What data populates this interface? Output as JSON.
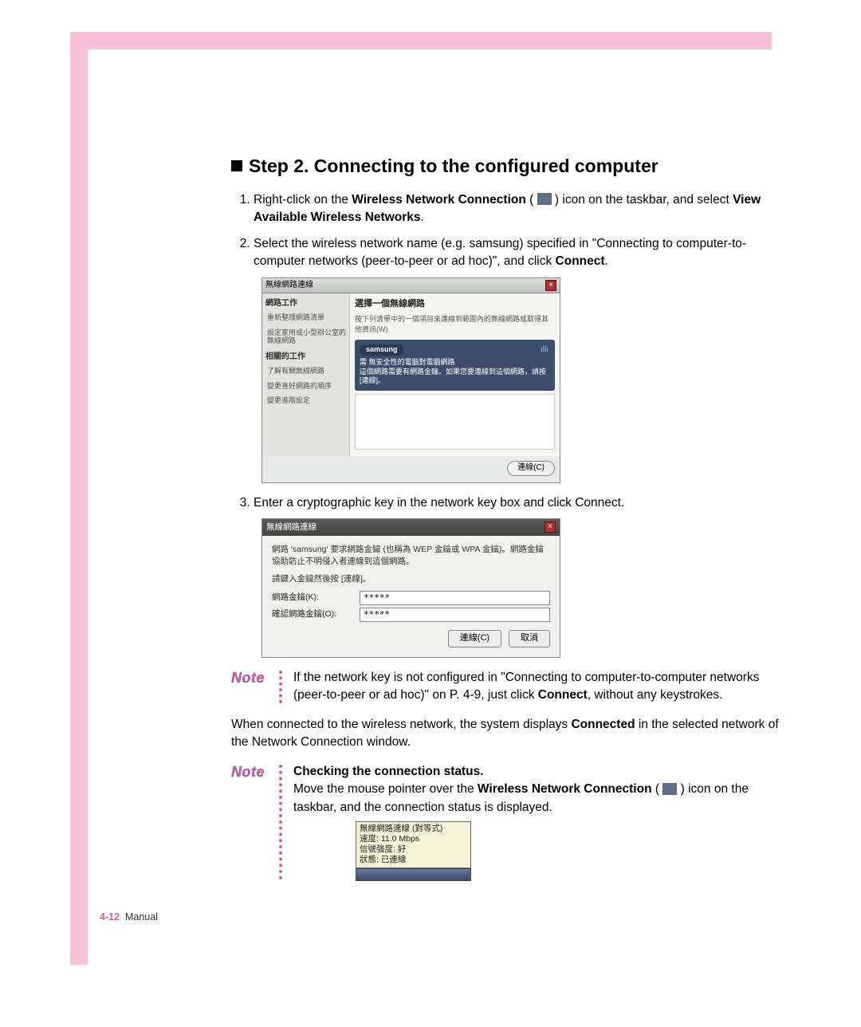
{
  "step": {
    "heading": "Step 2. Connecting to the configured computer",
    "items": [
      {
        "pre": "Right-click on the ",
        "bold1": "Wireless Network Connection",
        "mid": " ( ",
        "post_icon": " ) icon on the taskbar, and select ",
        "bold2": "View Available Wireless Networks",
        "end": "."
      },
      {
        "text_a": "Select the wireless network name (e.g. samsung) specified in \"Connecting to computer-to-computer networks (peer-to-peer or ad hoc)\", and click ",
        "bold": "Connect",
        "text_b": "."
      },
      {
        "text": "Enter a cryptographic key in the network key box and click Connect."
      }
    ]
  },
  "fig1": {
    "title": "無線網路連線",
    "left_h1": "網路工作",
    "left_i1": "重新整理網路清單",
    "left_i2": "設定家用或小型辦公室的無線網路",
    "left_h2": "相關的工作",
    "left_i3": "了解有關無線網路",
    "left_i4": "變更喜好網路的順序",
    "left_i5": "變更進階設定",
    "right_h": "選擇一個無線網路",
    "right_sub": "按下列清單中的一個項目來連線到範圍內的無線網路或取得其他資訊(W)",
    "net_name": "samsung",
    "net_line1": "需 無安全性的電腦對電腦網路",
    "net_line2": "這個網路需要有網路金鑰。如果您要連線到這個網路，請按 [連線]。",
    "btn": "連線(C)"
  },
  "fig2": {
    "title": "無線網路連線",
    "line1": "網路 'samsung' 要求網路金鑰 (也稱為 WEP 金鑰或 WPA 金鑰)。網路金鑰協助防止不明侵入者連線到這個網路。",
    "line2": "請鍵入金鑰然後按 [連線]。",
    "label1": "網路金鑰(K):",
    "label2": "確認網路金鑰(O):",
    "value": "*****",
    "btn_connect": "連線(C)",
    "btn_cancel": "取消"
  },
  "note1": {
    "label": "Note",
    "text_a": "If the network key is not configured in \"Connecting to computer-to-computer networks (peer-to-peer or ad hoc)\" on P. 4-9, just click ",
    "bold": "Connect",
    "text_b": ", without any keystrokes."
  },
  "para": {
    "a": "When connected to the wireless network, the system displays ",
    "bold": "Connected",
    "b": " in the selected network of the Network Connection window."
  },
  "note2": {
    "label": "Note",
    "heading": "Checking the connection status.",
    "text_a": "Move the mouse pointer over the ",
    "bold": "Wireless Network Connection",
    "text_b": " ( ",
    "text_c": " ) icon on the taskbar, and the connection status is displayed."
  },
  "tooltip": {
    "l1": "無線網路連線 (對等式)",
    "l2": "速度: 11.0 Mbps",
    "l3": "信號強度: 好",
    "l4": "狀態: 已連線"
  },
  "footer": {
    "page": "4-12",
    "label": "Manual"
  }
}
